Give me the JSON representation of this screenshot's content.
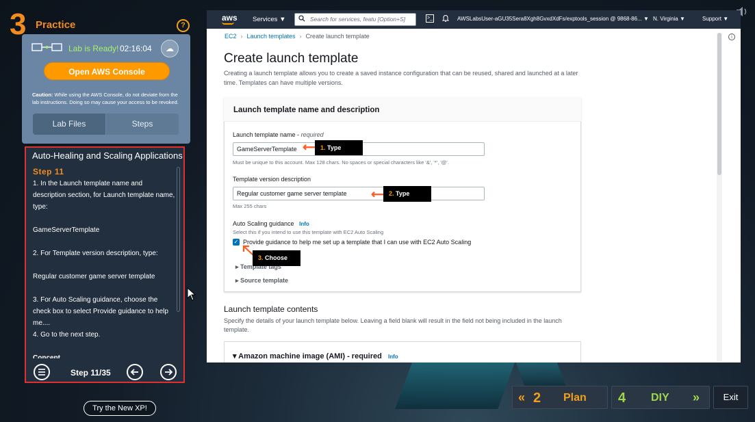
{
  "practice": {
    "step_number": "3",
    "title": "Practice",
    "help": "?",
    "lab_status": "Lab is Ready!",
    "timer": "02:16:04",
    "open_console": "Open AWS Console",
    "caution_label": "Caution:",
    "caution_text": "While using the AWS Console, do not deviate from the lab instructions. Doing so may cause your access to be revoked.",
    "tabs": [
      {
        "label": "Lab Files"
      },
      {
        "label": "Steps"
      }
    ],
    "steps_title": "Auto-Healing and Scaling Applications",
    "step_label": "Step 11",
    "instructions": [
      "1. In the Launch template name and description section, for Launch template name, type:",
      "GameServerTemplate",
      "2. For Template version description, type:",
      "Regular customer game server template",
      "3. For Auto Scaling guidance, choose the check box to select Provide guidance to help me....",
      "4. Go to the next step.",
      "Concept"
    ],
    "step_counter": "Step 11/35",
    "try_new_xp": "Try the New XP!"
  },
  "bottom_nav": {
    "plan_number": "2",
    "plan_label": "Plan",
    "diy_number": "4",
    "diy_label": "DIY",
    "exit_label": "Exit"
  },
  "aws": {
    "logo": "aws",
    "services": "Services ▼",
    "search_placeholder": "Search for services, featu [Option+S]",
    "account": "AWSLabsUser-aGU35Sera8Xgh8GvxdXdFs/exptools_session @ 9868-86... ▼",
    "region": "N. Virginia ▼",
    "support": "Support ▼",
    "breadcrumb": [
      "EC2",
      "Launch templates",
      "Create launch template"
    ],
    "page_title": "Create launch template",
    "page_desc": "Creating a launch template allows you to create a saved instance configuration that can be reused, shared and launched at a later time. Templates can have multiple versions.",
    "section_title": "Launch template name and description",
    "name_label": "Launch template name - ",
    "name_required": "required",
    "name_value": "GameServerTemplate",
    "name_hint": "Must be unique to this account. Max 128 chars. No spaces or special characters like '&', '*', '@'.",
    "desc_label": "Template version description",
    "desc_value": "Regular customer game server template",
    "desc_hint": "Max 255 chars",
    "asg_label": "Auto Scaling guidance",
    "info": "Info",
    "asg_hint": "Select this if you intend to use this template with EC2 Auto Scaling",
    "asg_checkbox": "Provide guidance to help me set up a template that I can use with EC2 Auto Scaling",
    "template_tags": "Template tags",
    "source_template": "Source template",
    "contents_title": "Launch template contents",
    "contents_desc": "Specify the details of your launch template below. Leaving a field blank will result in the field not being included in the launch template.",
    "ami_title": "Amazon machine image (AMI) - required"
  },
  "annotations": [
    {
      "num": "1.",
      "text": "Type"
    },
    {
      "num": "2.",
      "text": "Type"
    },
    {
      "num": "3.",
      "text": "Choose"
    }
  ],
  "colors": {
    "accent_orange": "#f28c1e",
    "aws_orange": "#ff9900",
    "aws_navy": "#232f3e",
    "aws_link": "#0073bb",
    "highlight_red": "#e0302f",
    "diy_green": "#9fd54b"
  },
  "icons": {
    "help": "question-circle-icon",
    "lab": "lab-connection-icon",
    "cloud": "cloud-download-icon",
    "list": "list-icon",
    "prev": "arrow-left-circle-icon",
    "next": "arrow-right-circle-icon",
    "sound": "speaker-icon"
  }
}
